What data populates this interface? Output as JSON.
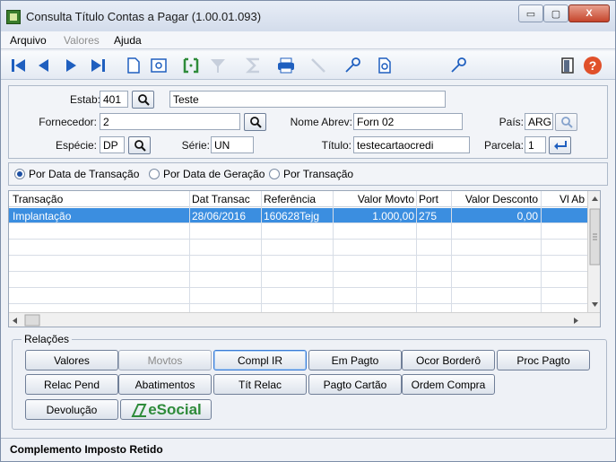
{
  "window": {
    "title": "Consulta Título Contas a Pagar (1.00.01.093)",
    "minimize": "▭",
    "maximize": "▢",
    "close": "X"
  },
  "menu": [
    {
      "label": "Arquivo",
      "enabled": true
    },
    {
      "label": "Valores",
      "enabled": false
    },
    {
      "label": "Ajuda",
      "enabled": true
    }
  ],
  "form": {
    "estab_label": "Estab:",
    "estab_code": "401",
    "estab_name": "Teste",
    "fornecedor_label": "Fornecedor:",
    "fornecedor_value": "2",
    "nome_abrev_label": "Nome Abrev:",
    "nome_abrev_value": "Forn 02",
    "pais_label": "País:",
    "pais_value": "ARG",
    "especie_label": "Espécie:",
    "especie_value": "DP",
    "serie_label": "Série:",
    "serie_value": "UN",
    "titulo_label": "Título:",
    "titulo_value": "testecartaocredi",
    "parcela_label": "Parcela:",
    "parcela_value": "1"
  },
  "radios": [
    {
      "label": "Por Data de Transação",
      "selected": true
    },
    {
      "label": "Por Data de Geração",
      "selected": false
    },
    {
      "label": "Por Transação",
      "selected": false
    }
  ],
  "grid": {
    "columns": [
      "Transação",
      "Dat Transac",
      "Referência",
      "Valor Movto",
      "Port",
      "Valor Desconto",
      "Vl Ab"
    ],
    "rows": [
      [
        "Implantação",
        "28/06/2016",
        "160628Tejg",
        "1.000,00",
        "275",
        "0,00",
        ""
      ]
    ]
  },
  "relacoes": {
    "title": "Relações",
    "buttons": [
      {
        "label": "Valores",
        "enabled": true
      },
      {
        "label": "Movtos",
        "enabled": false
      },
      {
        "label": "Compl IR",
        "enabled": true
      },
      {
        "label": "Em Pagto",
        "enabled": true
      },
      {
        "label": "Ocor Borderô",
        "enabled": true
      },
      {
        "label": "Proc Pagto",
        "enabled": true
      },
      {
        "label": "Relac Pend",
        "enabled": true
      },
      {
        "label": "Abatimentos",
        "enabled": true
      },
      {
        "label": "Tít Relac",
        "enabled": true
      },
      {
        "label": "Pagto Cartão",
        "enabled": true
      },
      {
        "label": "Ordem Compra",
        "enabled": true
      },
      {
        "label": "Devolução",
        "enabled": true
      }
    ],
    "esocial_label": "eSocial"
  },
  "status": "Complemento Imposto Retido",
  "colors": {
    "accent": "#3b8ee0",
    "toolbar_icon": "#1f5fbf",
    "help": "#e0502a",
    "esocial": "#2e8b3a"
  }
}
